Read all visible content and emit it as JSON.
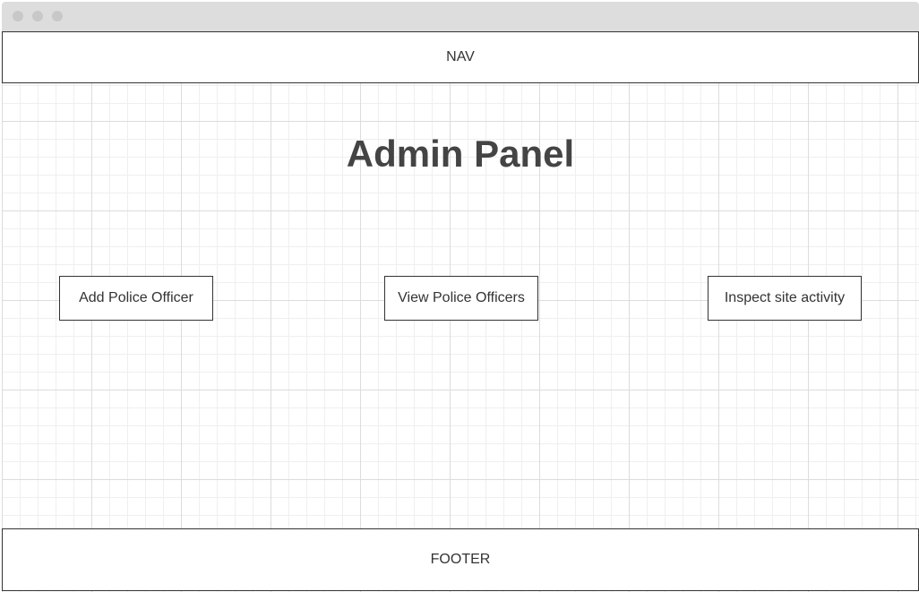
{
  "nav": {
    "label": "NAV"
  },
  "main": {
    "title": "Admin Panel",
    "actions": [
      {
        "label": "Add Police Officer"
      },
      {
        "label": "View Police Officers"
      },
      {
        "label": "Inspect site activity"
      }
    ]
  },
  "footer": {
    "label": "FOOTER"
  },
  "colors": {
    "titlebar": "#dddddd",
    "window_dots": "#c8c8c8",
    "border": "#333333",
    "text": "#333333",
    "title_text": "#444444",
    "grid_major": "#dcdcdc",
    "grid_minor": "#efefef"
  }
}
